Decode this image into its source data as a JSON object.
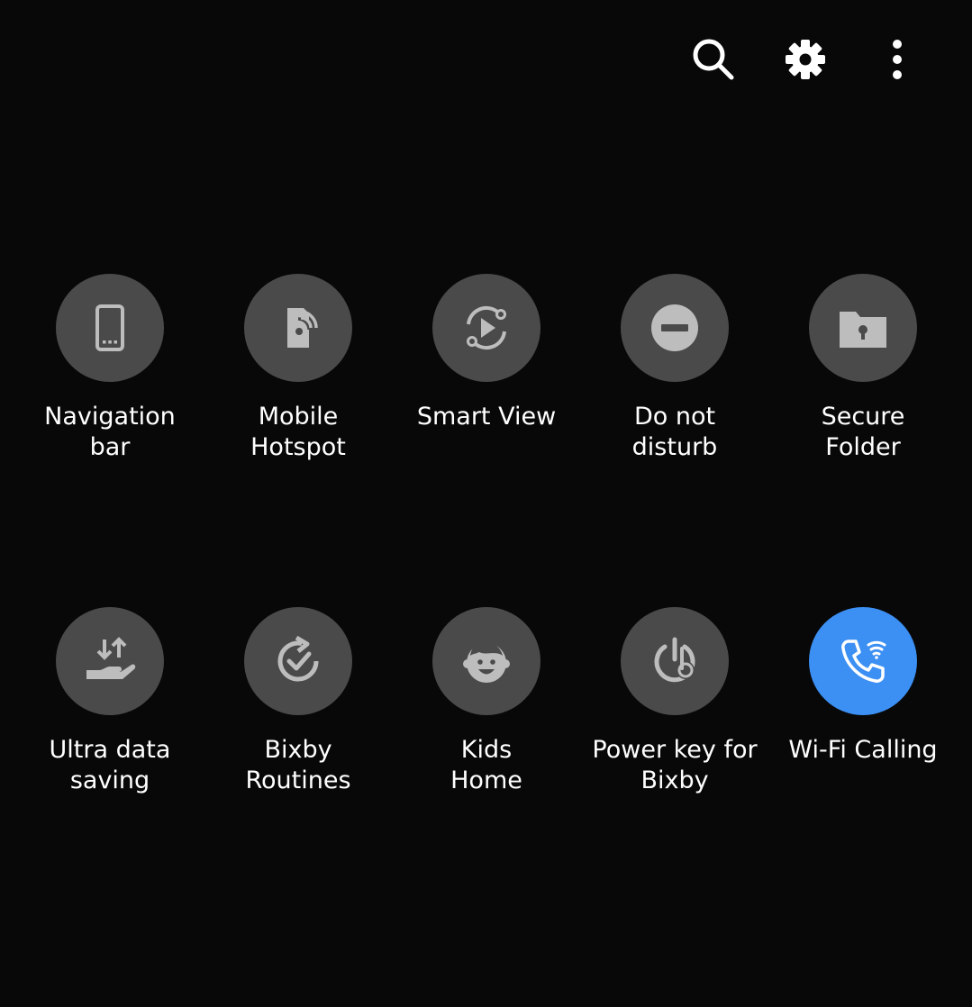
{
  "colors": {
    "background": "#080808",
    "tile_off": "#4a4a4a",
    "tile_on": "#3c8ff3",
    "icon_off": "#bdbdbd",
    "icon_on": "#ffffff",
    "label": "#ffffff"
  },
  "topbar": {
    "icons": [
      "search-icon",
      "settings-gear-icon",
      "more-options-icon"
    ]
  },
  "tiles": [
    {
      "icon": "navigation-bar-icon",
      "line1": "Navigation",
      "line2": "bar",
      "active": false
    },
    {
      "icon": "mobile-hotspot-icon",
      "line1": "Mobile",
      "line2": "Hotspot",
      "active": false
    },
    {
      "icon": "smart-view-icon",
      "line1": "Smart View",
      "line2": "",
      "active": false
    },
    {
      "icon": "do-not-disturb-icon",
      "line1": "Do not",
      "line2": "disturb",
      "active": false
    },
    {
      "icon": "secure-folder-icon",
      "line1": "Secure",
      "line2": "Folder",
      "active": false
    },
    {
      "icon": "ultra-data-saving-icon",
      "line1": "Ultra data",
      "line2": "saving",
      "active": false
    },
    {
      "icon": "bixby-routines-icon",
      "line1": "Bixby",
      "line2": "Routines",
      "active": false
    },
    {
      "icon": "kids-home-icon",
      "line1": "Kids",
      "line2": "Home",
      "active": false
    },
    {
      "icon": "power-key-bixby-icon",
      "line1": "Power key for",
      "line2": "Bixby",
      "active": false
    },
    {
      "icon": "wifi-calling-icon",
      "line1": "Wi-Fi Calling",
      "line2": "",
      "active": true
    }
  ]
}
